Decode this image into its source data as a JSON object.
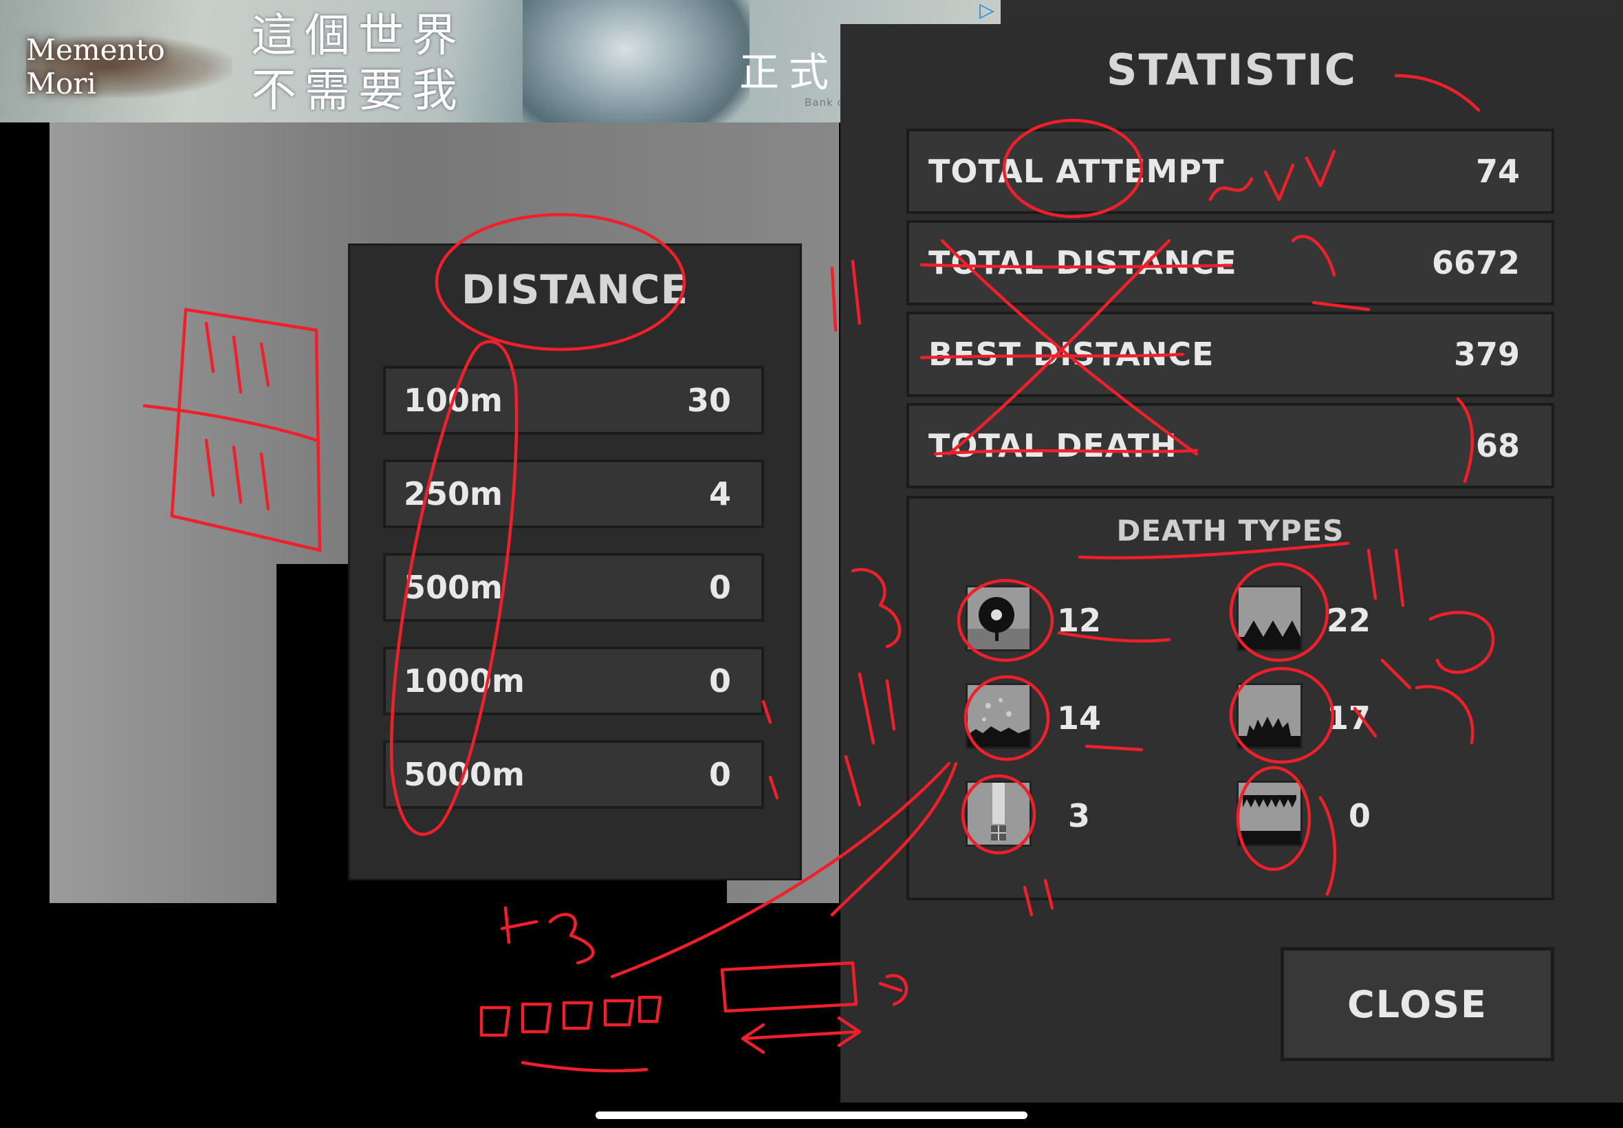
{
  "ad_banner": {
    "logo_text": "Memento Mori",
    "slogan_line1": "這個世界",
    "slogan_line2": "不需要我",
    "launch_text": "正式上市！",
    "credit": "Bank of Innovation Inc.",
    "adchoices_icon": "ad-choices-icon"
  },
  "distance_panel": {
    "title": "DISTANCE",
    "rows": [
      {
        "label": "100m",
        "value": "30"
      },
      {
        "label": "250m",
        "value": "4"
      },
      {
        "label": "500m",
        "value": "0"
      },
      {
        "label": "1000m",
        "value": "0"
      },
      {
        "label": "5000m",
        "value": "0"
      }
    ]
  },
  "statistic_panel": {
    "title": "STATISTIC",
    "rows": [
      {
        "label": "TOTAL ATTEMPT",
        "value": "74"
      },
      {
        "label": "TOTAL DISTANCE",
        "value": "6672"
      },
      {
        "label": "BEST DISTANCE",
        "value": "379"
      },
      {
        "label": "TOTAL DEATH",
        "value": "68"
      }
    ],
    "death_types": {
      "title": "DEATH TYPES",
      "items": [
        {
          "icon": "saw-blade-icon",
          "count": "12"
        },
        {
          "icon": "floor-spikes-icon",
          "count": "22"
        },
        {
          "icon": "falling-debris-icon",
          "count": "14"
        },
        {
          "icon": "spiky-creature-icon",
          "count": "17"
        },
        {
          "icon": "crusher-pillar-icon",
          "count": "3"
        },
        {
          "icon": "ceiling-spikes-icon",
          "count": "0"
        }
      ]
    },
    "close_label": "CLOSE"
  },
  "colors": {
    "panel_bg": "#2d2d2d",
    "row_bg": "#363636",
    "row_border": "#1b1b1b",
    "text": "#e8e8e8",
    "annotation_red": "#f0202a"
  }
}
